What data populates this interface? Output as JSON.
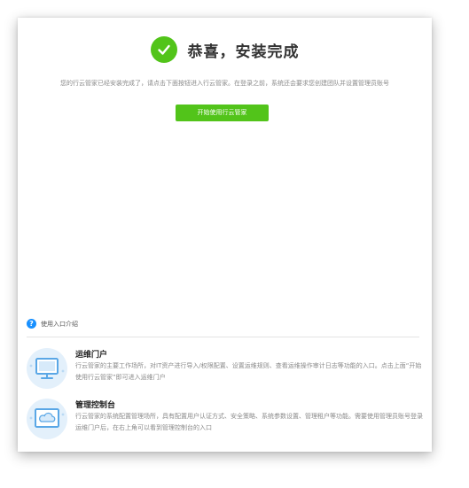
{
  "colors": {
    "accent_green": "#52c41a",
    "help_blue": "#1890ff",
    "icon_blue": "#5aa7e6",
    "icon_bg": "#e3f0fb"
  },
  "success": {
    "icon": "check-circle-icon",
    "title": "恭喜，安装完成",
    "description": "您的行云管家已经安装完成了，请点击下面按钮进入行云管家。在登录之前，系统还会要求您创建团队并设置管理员账号",
    "start_button_label": "开始使用行云管家"
  },
  "intro": {
    "icon": "help-icon",
    "title": "使用入口介绍",
    "entries": [
      {
        "icon": "monitor-icon",
        "title": "运维门户",
        "description": "行云管家的主要工作场所，对IT资产进行导入/权限配置、设置运维规则、查看运维操作审计日志等功能的入口。点击上面“开始使用行云管家”即可进入运维门户"
      },
      {
        "icon": "cloud-console-icon",
        "title": "管理控制台",
        "description": "行云管家的系统配置管理场所，具有配置用户认证方式、安全策略、系统参数设置、管理租户等功能。需要使用管理员账号登录运维门户后，在右上角可以看到管理控制台的入口"
      }
    ]
  }
}
